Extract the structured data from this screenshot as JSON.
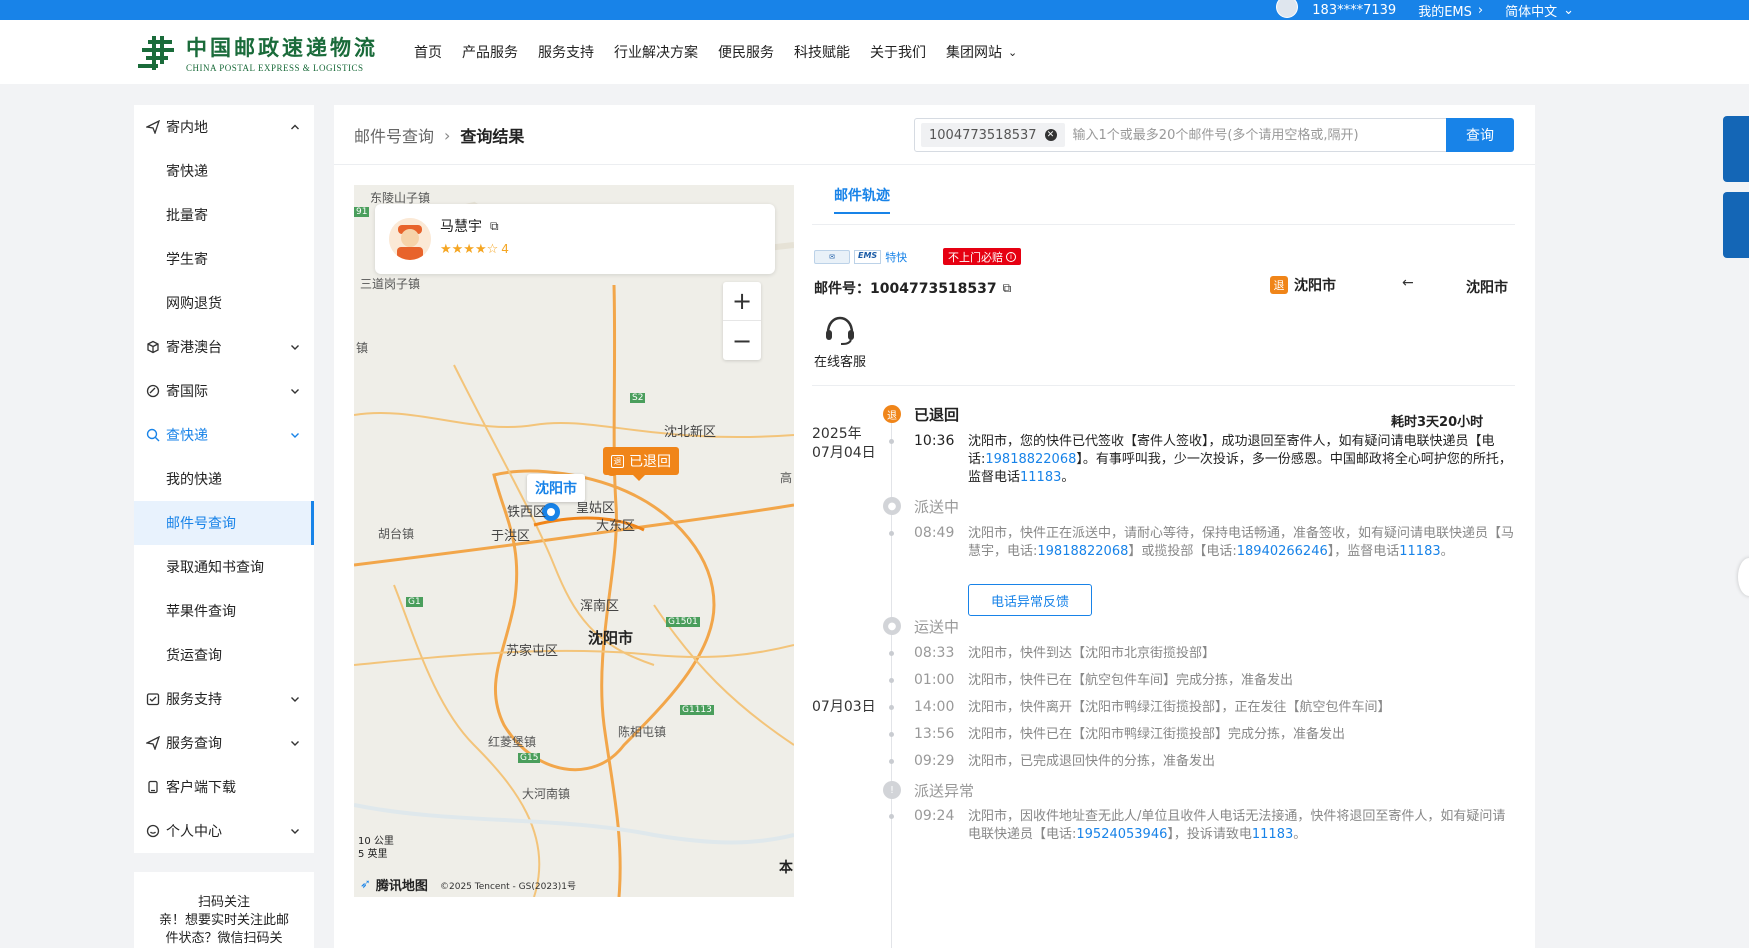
{
  "topbar": {
    "phone": "183****7139",
    "my_ems": "我的EMS",
    "language": "简体中文"
  },
  "header": {
    "logo_cn": "中国邮政速递物流",
    "logo_en": "CHINA POSTAL EXPRESS & LOGISTICS",
    "nav": [
      "首页",
      "产品服务",
      "服务支持",
      "行业解决方案",
      "便民服务",
      "科技赋能",
      "关于我们",
      "集团网站"
    ]
  },
  "sidebar": {
    "items": [
      {
        "label": "寄内地",
        "level": "top",
        "icon": "send-icon",
        "chevron": "up"
      },
      {
        "label": "寄快递",
        "level": "sub"
      },
      {
        "label": "批量寄",
        "level": "sub"
      },
      {
        "label": "学生寄",
        "level": "sub"
      },
      {
        "label": "网购退货",
        "level": "sub"
      },
      {
        "label": "寄港澳台",
        "level": "top",
        "icon": "box-icon",
        "chevron": "down"
      },
      {
        "label": "寄国际",
        "level": "top",
        "icon": "globe-icon",
        "chevron": "down"
      },
      {
        "label": "查快递",
        "level": "top",
        "icon": "search-icon",
        "chevron": "down",
        "blue": true
      },
      {
        "label": "我的快递",
        "level": "sub"
      },
      {
        "label": "邮件号查询",
        "level": "sub",
        "active": true
      },
      {
        "label": "录取通知书查询",
        "level": "sub"
      },
      {
        "label": "苹果件查询",
        "level": "sub"
      },
      {
        "label": "货运查询",
        "level": "sub"
      },
      {
        "label": "服务支持",
        "level": "top",
        "icon": "support-icon",
        "chevron": "down"
      },
      {
        "label": "服务查询",
        "level": "top",
        "icon": "service-query-icon",
        "chevron": "down"
      },
      {
        "label": "客户端下载",
        "level": "top",
        "icon": "download-icon",
        "chevron": ""
      },
      {
        "label": "个人中心",
        "level": "top",
        "icon": "user-icon",
        "chevron": "down"
      }
    ],
    "qr_title": "扫码关注",
    "qr_line2": "亲！想要实时关注此邮",
    "qr_line3": "件状态？微信扫码关"
  },
  "main": {
    "breadcrumb": {
      "parent": "邮件号查询",
      "current": "查询结果"
    },
    "search": {
      "chip": "1004773518537",
      "placeholder": "输入1个或最多20个邮件号(多个请用空格或,隔开)",
      "button": "查询"
    },
    "map": {
      "courier_name": "马慧宇",
      "courier_stars": "★★★★☆",
      "courier_rating": "4",
      "returned_pin": "已退回",
      "city_pin": "沈阳市",
      "labels": [
        "东陵山子镇",
        "三道岗子镇",
        "镇",
        "沈北新区",
        "铁西区",
        "皇姑区",
        "于洪区",
        "大东区",
        "胡台镇",
        "浑南区",
        "沈阳市",
        "苏家屯区",
        "红菱堡镇",
        "陈相屯镇",
        "大河南镇",
        "高"
      ],
      "road_labels": [
        "S2",
        "G1",
        "G1501",
        "G1113",
        "G15",
        "91"
      ],
      "scale_km": "10 公里",
      "scale_mi": "5 英里",
      "brand": "腾讯地图",
      "copyright": "©2025 Tencent - GS(2023)1号",
      "corner": "本"
    },
    "tab": "邮件轨迹",
    "ems_tag": "特快",
    "red_badge": "不上门必赔",
    "waybill_label": "邮件号：1004773518537",
    "route": {
      "badge": "退",
      "from": "沈阳市",
      "arrow": "←",
      "to": "沈阳市"
    },
    "customer_service": "在线客服",
    "elapsed": "耗时3天20小时",
    "feedback_button": "电话异常反馈",
    "dates": {
      "year": "2025年",
      "d1": "07月04日",
      "d2": "07月03日"
    },
    "timeline": {
      "s1": "已退回",
      "t1": "10:36",
      "e1a": "沈阳市，您的快件已代签收【寄件人签收】，成功退回至寄件人，如有疑问请电联快递员【电话:",
      "e1p": "19818822068",
      "e1b": "】。有事呼叫我，少一次投诉，多一份感恩。中国邮政将全心呵护您的所托，监督电话",
      "e1p2": "11183",
      "e1c": "。",
      "s2": "派送中",
      "t2": "08:49",
      "e2a": "沈阳市，快件正在派送中，请耐心等待，保持电话畅通，准备签收，如有疑问请电联快递员【马慧宇，电话:",
      "e2p": "19818822068",
      "e2b": "】或揽投部【电话:",
      "e2p2": "18940266246",
      "e2c": "】，监督电话",
      "e2p3": "11183",
      "e2d": "。",
      "s3": "运送中",
      "t3": "08:33",
      "e3": "沈阳市，快件到达【沈阳市北京街揽投部】",
      "t4": "01:00",
      "e4": "沈阳市，快件已在【航空包件车间】完成分拣，准备发出",
      "t5": "14:00",
      "e5": "沈阳市，快件离开【沈阳市鸭绿江街揽投部】，正在发往【航空包件车间】",
      "t6": "13:56",
      "e6": "沈阳市，快件已在【沈阳市鸭绿江街揽投部】完成分拣，准备发出",
      "t7": "09:29",
      "e7": "沈阳市，已完成退回快件的分拣，准备发出",
      "s4": "派送异常",
      "t8": "09:24",
      "e8a": "沈阳市，因收件地址查无此人/单位且收件人电话无法接通，快件将退回至寄件人，如有疑问请电联快递员【电话:",
      "e8p": "19524053946",
      "e8b": "】，投诉请致电",
      "e8p2": "11183",
      "e8c": "。"
    }
  },
  "colors": {
    "brand_blue": "#1883e8",
    "orange": "#f08519",
    "red": "#e60012",
    "logo_green": "#1a6b3a"
  }
}
